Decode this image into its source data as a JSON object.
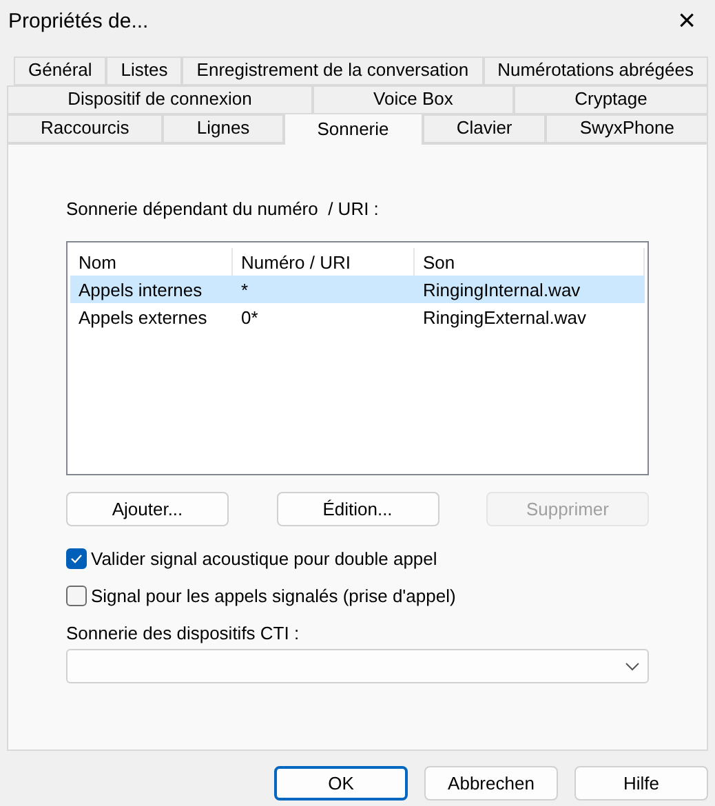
{
  "window": {
    "title": "Propriétés de...",
    "close": "×"
  },
  "tab_rows": [
    {
      "tabs": [
        {
          "label": "Général",
          "selected": false
        },
        {
          "label": "Listes",
          "selected": false
        },
        {
          "label": "Enregistrement de la conversation",
          "selected": false
        },
        {
          "label": "Numérotations abrégées",
          "selected": false
        }
      ]
    },
    {
      "tabs": [
        {
          "label": "Dispositif de connexion",
          "selected": false
        },
        {
          "label": "Voice Box",
          "selected": false
        },
        {
          "label": "Cryptage",
          "selected": false
        }
      ]
    },
    {
      "tabs": [
        {
          "label": "Raccourcis",
          "selected": false
        },
        {
          "label": "Lignes",
          "selected": false
        },
        {
          "label": "Sonnerie",
          "selected": true
        },
        {
          "label": "Clavier",
          "selected": false
        },
        {
          "label": "SwyxPhone",
          "selected": false
        }
      ]
    }
  ],
  "ring_section": {
    "label": "Sonnerie dépendant du numéro  / URI :"
  },
  "table": {
    "columns": [
      "Nom",
      "Numéro / URI",
      "Son"
    ],
    "rows": [
      {
        "cells": [
          "Appels internes",
          "*",
          "RingingInternal.wav"
        ],
        "selected": true
      },
      {
        "cells": [
          "Appels externes",
          "0*",
          "RingingExternal.wav"
        ],
        "selected": false
      }
    ]
  },
  "list_buttons": [
    {
      "label": "Ajouter...",
      "disabled": false
    },
    {
      "label": "Édition...",
      "disabled": false
    },
    {
      "label": "Supprimer",
      "disabled": true
    }
  ],
  "checkboxes": [
    {
      "label": "Valider signal acoustique pour double appel",
      "checked": true
    },
    {
      "label": "Signal pour les appels signalés (prise d'appel)",
      "checked": false
    }
  ],
  "cti": {
    "label": "Sonnerie des dispositifs CTI :"
  },
  "footer_buttons": [
    {
      "label": "OK",
      "default": true
    },
    {
      "label": "Abbrechen",
      "default": false
    },
    {
      "label": "Hilfe",
      "default": false
    }
  ]
}
